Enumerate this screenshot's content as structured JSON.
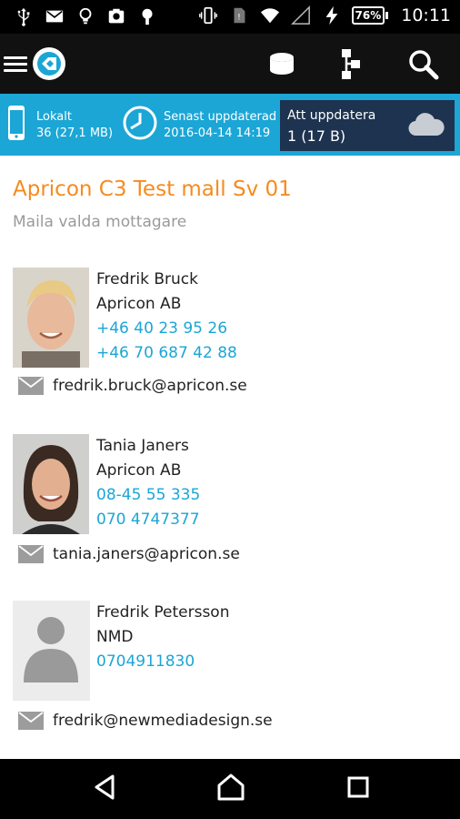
{
  "status_bar": {
    "battery_percent": "76%",
    "time": "10:11",
    "left_icons": [
      "usb-icon",
      "mail-icon",
      "lightbulb-icon",
      "photo-icon",
      "android-icon"
    ],
    "right_icons": [
      "vibrate-icon",
      "sim-icon",
      "wifi-icon",
      "signal-icon",
      "charging-icon"
    ]
  },
  "app_bar": {
    "icons": [
      "menu-icon",
      "app-logo-icon",
      "database-icon",
      "hierarchy-icon",
      "search-icon"
    ]
  },
  "sync_bar": {
    "local": {
      "label": "Lokalt",
      "value": "36 (27,1 MB)"
    },
    "last_update": {
      "label": "Senast uppdaterad",
      "value": "2016-04-14 14:19"
    },
    "pending": {
      "label": "Att uppdatera",
      "value": "1 (17 B)"
    }
  },
  "page": {
    "title": "Apricon C3 Test mall Sv 01",
    "subtitle": "Maila valda mottagare"
  },
  "contacts": [
    {
      "name": "Fredrik Bruck",
      "company": "Apricon AB",
      "phones": [
        "+46 40 23 95 26",
        "+46 70 687 42 88"
      ],
      "email": "fredrik.bruck@apricon.se"
    },
    {
      "name": "Tania Janers",
      "company": "Apricon AB",
      "phones": [
        "08-45 55 335",
        "070 4747377"
      ],
      "email": "tania.janers@apricon.se"
    },
    {
      "name": "Fredrik Petersson",
      "company": "NMD",
      "phones": [
        "0704911830"
      ],
      "email": "fredrik@newmediadesign.se"
    }
  ],
  "nav_bar": {
    "icons": [
      "back-icon",
      "home-icon",
      "recents-icon"
    ]
  },
  "colors": {
    "accent": "#1ba6d6",
    "title": "#f68b1f",
    "pending_bg": "#1d3350",
    "phone_link": "#1ba6d6"
  }
}
